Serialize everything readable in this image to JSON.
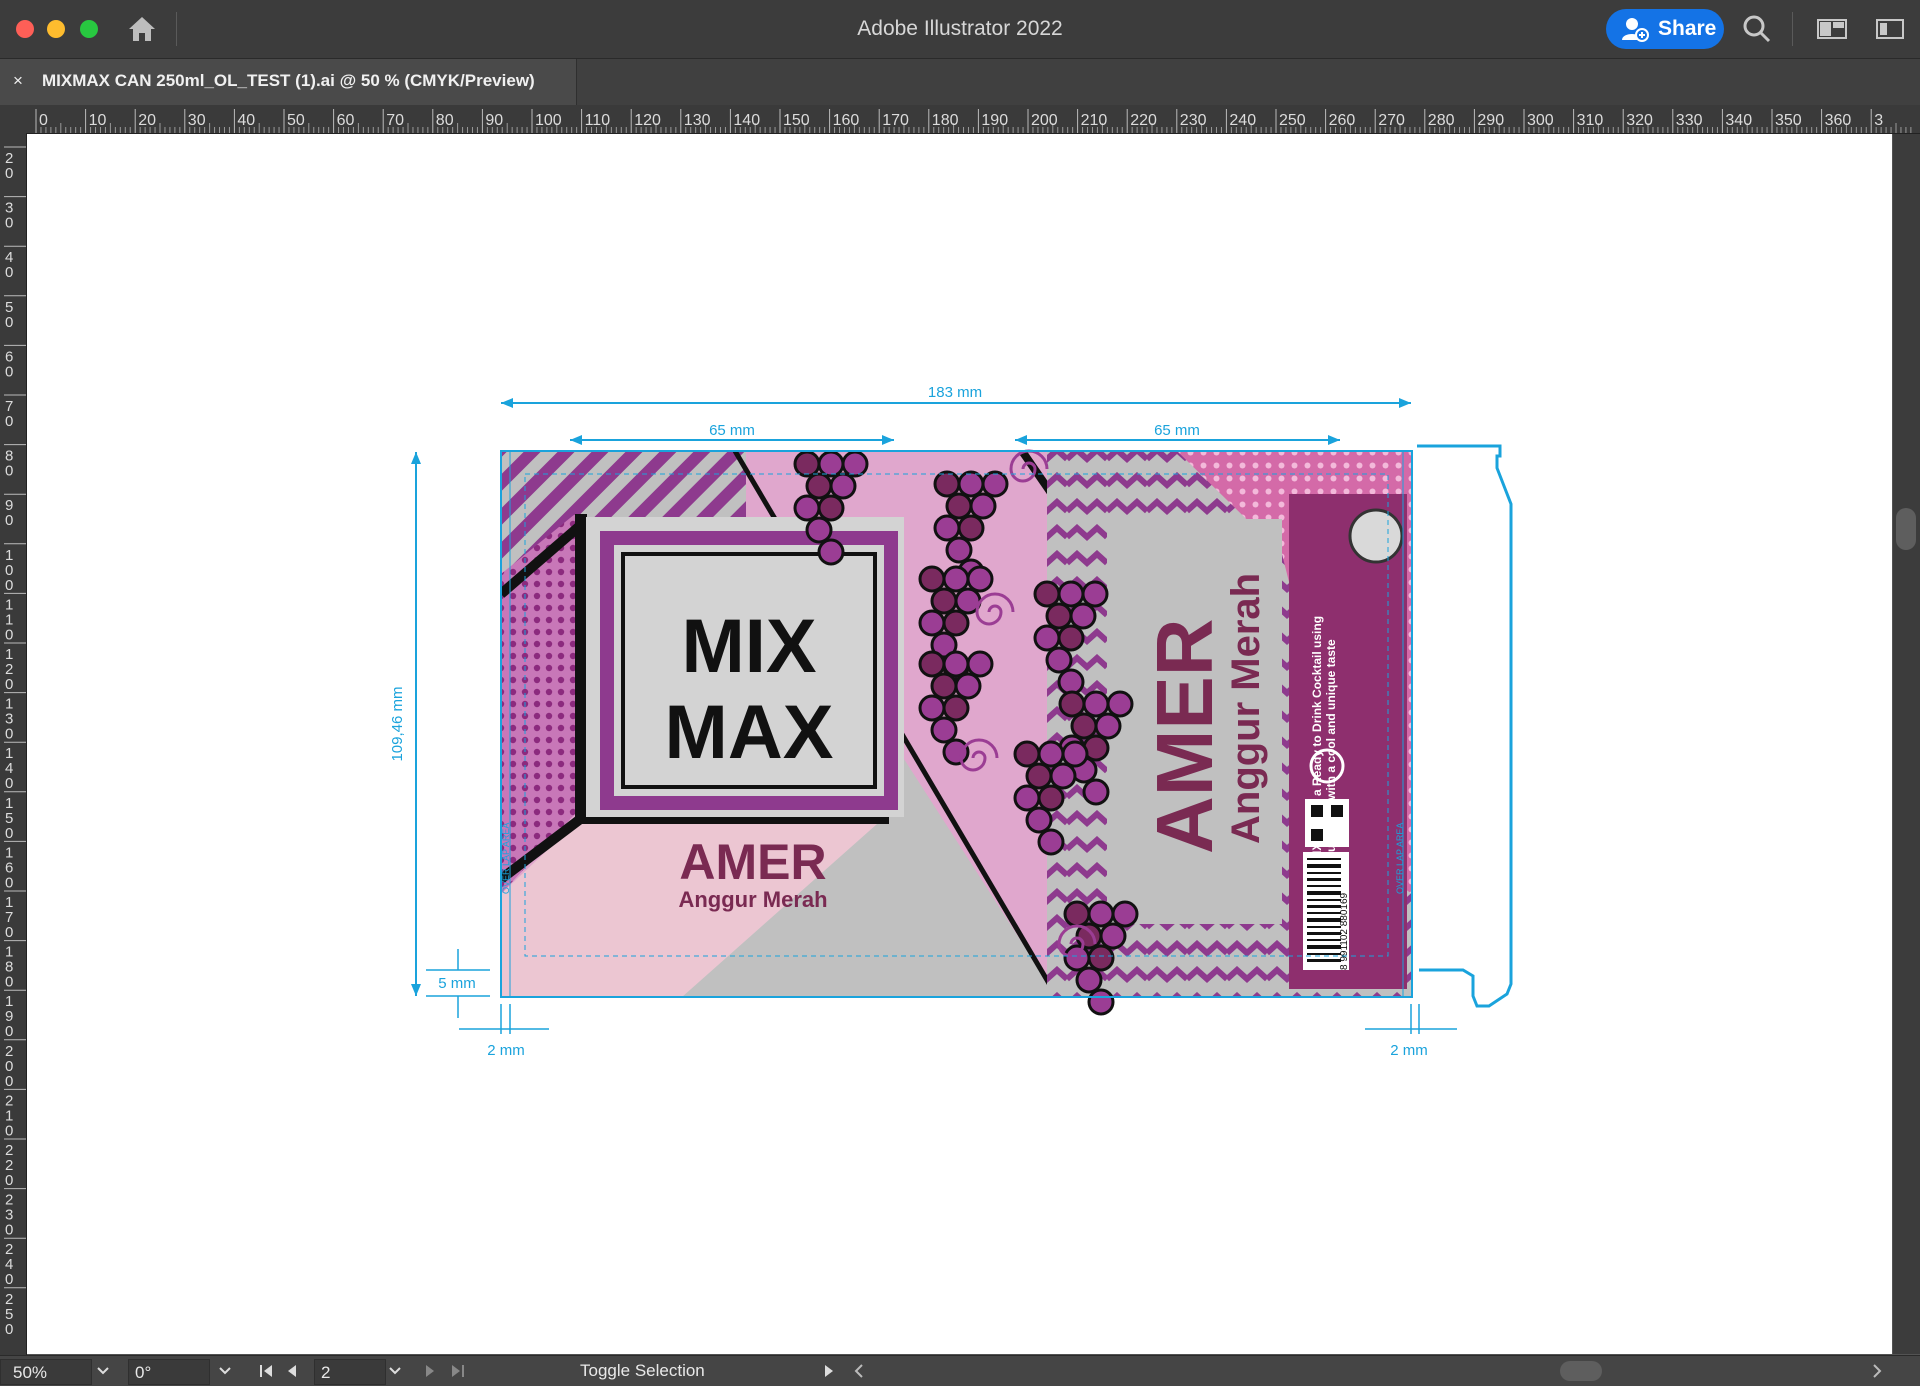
{
  "app": {
    "title": "Adobe Illustrator 2022",
    "share_label": "Share"
  },
  "document_tab": {
    "close_glyph": "×",
    "name": "MIXMAX CAN 250ml_OL_TEST (1).ai @ 50 % (CMYK/Preview)"
  },
  "rulers": {
    "horizontal_labels": [
      "0",
      "10",
      "20",
      "30",
      "40",
      "50",
      "60",
      "70",
      "80",
      "90",
      "100",
      "110",
      "120",
      "130",
      "140",
      "150",
      "160",
      "170",
      "180",
      "190",
      "200",
      "210",
      "220",
      "230",
      "240",
      "250",
      "260",
      "270",
      "280",
      "290",
      "300",
      "310",
      "320",
      "330",
      "340",
      "350",
      "360",
      "3"
    ],
    "vertical_labels": [
      "20",
      "30",
      "40",
      "50",
      "60",
      "70",
      "80",
      "90",
      "100",
      "110",
      "120",
      "130",
      "140",
      "150",
      "160",
      "170",
      "180",
      "190",
      "200",
      "210",
      "220",
      "230",
      "240",
      "250"
    ]
  },
  "artwork": {
    "dim_total_width": "183 mm",
    "dim_front_panel_left": "65 mm",
    "dim_front_panel_right": "65 mm",
    "dim_height": "109,46 mm",
    "dim_bottom_margin": "5 mm",
    "dim_bleed_left": "2 mm",
    "dim_bleed_right": "2 mm",
    "logo_line1": "MIX",
    "logo_line2": "MAX",
    "product_name": "AMER",
    "product_flavor": "Anggur Merah",
    "overlap_label": "OVER LAP AREA",
    "description": "MIX MAX is a Ready to Drink Cocktail using",
    "description_line2": "Fruit Juice with a cool and unique taste",
    "barcode_number": "8 991102 880169",
    "colors": {
      "pink_bg": "#e0a7cd",
      "light_pink": "#ecc6d2",
      "grey_panel": "#c0c0c0",
      "purple_stripe": "#8e3a8e",
      "grape": "#9b3d94",
      "wine_text": "#7a2a52",
      "dimension_line": "#1aa3dc"
    }
  },
  "statusbar": {
    "zoom": "50%",
    "rotation": "0°",
    "artboard_number": "2",
    "toggle_label": "Toggle Selection"
  }
}
